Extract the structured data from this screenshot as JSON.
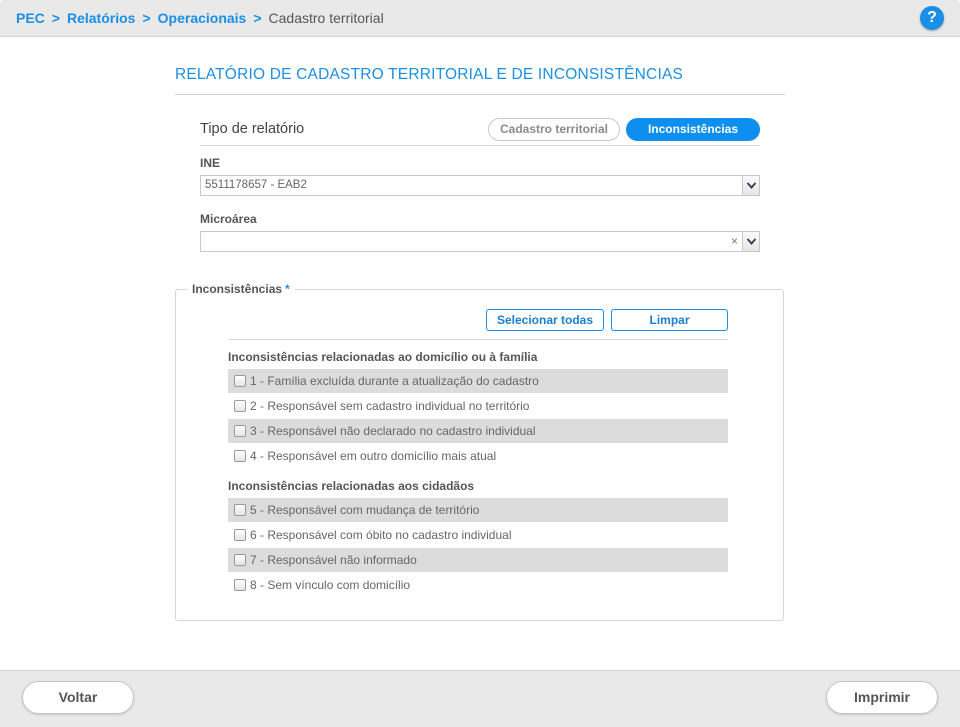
{
  "breadcrumb": {
    "items": [
      "PEC",
      "Relatórios",
      "Operacionais"
    ],
    "separator": ">",
    "current": "Cadastro territorial"
  },
  "help": {
    "label": "?"
  },
  "title": "RELATÓRIO DE CADASTRO TERRITORIAL E DE INCONSISTÊNCIAS",
  "tipo": {
    "label": "Tipo de relatório",
    "options": [
      "Cadastro territorial",
      "Inconsistências"
    ],
    "selected": "Inconsistências"
  },
  "ine": {
    "label": "INE",
    "value": "5511178657 - EAB2"
  },
  "microarea": {
    "label": "Microárea",
    "value": "",
    "clear": "×"
  },
  "inconsistencias": {
    "legend": "Inconsistências",
    "required_mark": "*",
    "select_all": "Selecionar todas",
    "clear": "Limpar",
    "groups": [
      {
        "title": "Inconsistências relacionadas ao domicílio ou à família",
        "items": [
          "1 - Família excluída durante a atualização do cadastro",
          "2 - Responsável sem cadastro individual no território",
          "3 - Responsável não declarado no cadastro individual",
          "4 - Responsável em outro domicílio mais atual"
        ]
      },
      {
        "title": "Inconsistências relacionadas aos cidadãos",
        "items": [
          "5 - Responsável com mudança de território",
          "6 - Responsável com óbito no cadastro individual",
          "7 - Responsável não informado",
          "8 - Sem vínculo com domicílio"
        ]
      }
    ]
  },
  "footer": {
    "back": "Voltar",
    "print": "Imprimir"
  },
  "colors": {
    "accent": "#1a8fe3",
    "bar": "#e9e9e9",
    "row_shade": "#dcdcdc"
  }
}
